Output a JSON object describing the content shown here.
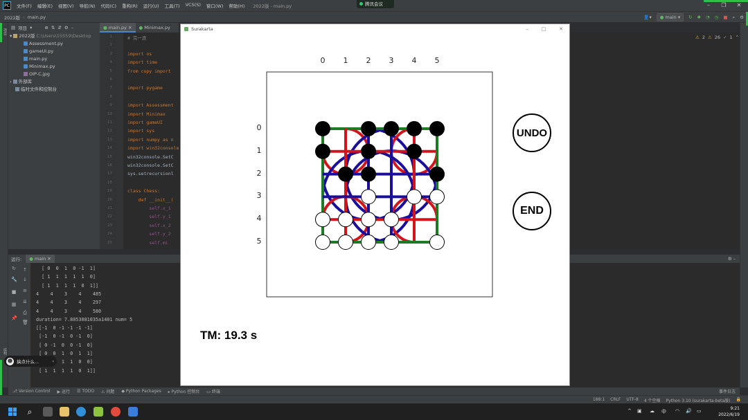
{
  "ide": {
    "menus": [
      "文件(F)",
      "编辑(E)",
      "视图(V)",
      "导航(N)",
      "代码(C)",
      "重构(R)",
      "运行(U)",
      "工具(T)",
      "VCS(S)",
      "窗口(W)",
      "帮助(H)"
    ],
    "window_title": "2022版 - main.py",
    "meeting_app": "腾讯会议",
    "breadcrumb": [
      "2022版",
      "main.py"
    ],
    "run_config": "main",
    "project_label": "项目",
    "tabs": [
      "main.py",
      "Minimax.py"
    ],
    "project_tree": {
      "root": "2022版",
      "root_path": "C:\\Users\\15559\\Desktop",
      "files": [
        "Assessment.py",
        "gameUI.py",
        "main.py",
        "Minimax.py",
        "OIP-C.jpg"
      ],
      "ext_libs": "外部库",
      "scratches": "临时文件和控制台"
    },
    "warnings": {
      "warn": "2",
      "weak": "26",
      "typo": "1"
    },
    "line_numbers": [
      "1",
      "2",
      "3",
      "4",
      "5",
      "6",
      "7",
      "8",
      "9",
      "10",
      "11",
      "12",
      "13",
      "14",
      "15",
      "16",
      "17",
      "18",
      "19",
      "20",
      "21",
      "22",
      "23",
      "24",
      "25"
    ],
    "code_lines": [
      {
        "t": "# 完一逐",
        "cls": "cm"
      },
      {
        "t": ""
      },
      {
        "t": "import os",
        "cls": "imp"
      },
      {
        "t": "import time",
        "cls": "imp"
      },
      {
        "t": "from copy import",
        "cls": "imp"
      },
      {
        "t": ""
      },
      {
        "t": "import pygame",
        "cls": "imp"
      },
      {
        "t": ""
      },
      {
        "t": "import Assessment",
        "cls": "imp"
      },
      {
        "t": "import Minimax",
        "cls": "imp"
      },
      {
        "t": "import gameUI",
        "cls": "imp"
      },
      {
        "t": "import sys",
        "cls": "imp"
      },
      {
        "t": "import numpy as n",
        "cls": "imp"
      },
      {
        "t": "import win32console",
        "cls": "imp"
      },
      {
        "t": "win32console.SetC",
        "cls": ""
      },
      {
        "t": "win32console.SetC",
        "cls": ""
      },
      {
        "t": "sys.setrecursionl",
        "cls": ""
      },
      {
        "t": ""
      },
      {
        "t": "class Chess:",
        "cls": "cls"
      },
      {
        "t": "    def __init__(",
        "cls": "def"
      },
      {
        "t": "        self.x_1",
        "cls": "self"
      },
      {
        "t": "        self.y_1",
        "cls": "self"
      },
      {
        "t": "        self.x_2",
        "cls": "self"
      },
      {
        "t": "        self.y_2",
        "cls": "self"
      },
      {
        "t": "        self.mi",
        "cls": "self"
      }
    ],
    "run_panel": {
      "label": "运行:",
      "tab": "main",
      "console": [
        "  [ 0  0  1  0 -1  1]",
        "  [ 1  1  1  1  1  0]",
        "  [ 1  1  1  1  0  1]]",
        "4    4    3    4    485",
        "4    4    3    4    297",
        "4    4    3    4    580",
        "duration= 7.8053081035a1401 num= 5",
        "[[-1  0 -1 -1 -1 -1]",
        " [-1  0 -1  0 -1  0]",
        " [ 0 -1  0  0 -1  0]",
        " [ 0  0  1  0  1  1]",
        " [ 1  1  1  1  0  0]",
        " [ 1  1  1  1  0  1]]"
      ]
    },
    "bubble_text": "搞点什么...",
    "bottom_tools": [
      "Version Control",
      "运行",
      "TODO",
      "问题",
      "Python Packages",
      "Python 控制台",
      "终端"
    ],
    "event_log": "事件日志",
    "status": {
      "pos": "188:1",
      "crlf": "CRLF",
      "enc": "UTF-8",
      "indent": "4 个空格",
      "interp": "Python 3.10 (surakarta-beta版)"
    },
    "clock": {
      "time": "9:21",
      "date": "2022/6/19"
    },
    "tray": [
      "^",
      "中"
    ]
  },
  "game": {
    "window_title": "Surakarta",
    "col_labels": [
      "0",
      "1",
      "2",
      "3",
      "4",
      "5"
    ],
    "row_labels": [
      "0",
      "1",
      "2",
      "3",
      "4",
      "5"
    ],
    "board": [
      [
        "B",
        "E",
        "B",
        "B",
        "B",
        "B"
      ],
      [
        "B",
        "E",
        "B",
        "E",
        "B",
        "E"
      ],
      [
        "E",
        "B",
        "B",
        "E",
        "E",
        "B"
      ],
      [
        "E",
        "E",
        "W",
        "E",
        "W",
        "W"
      ],
      [
        "W",
        "W",
        "W",
        "W",
        "E",
        "E"
      ],
      [
        "W",
        "W",
        "W",
        "W",
        "E",
        "W"
      ]
    ],
    "colors": {
      "outer_loop": "#1a0f9c",
      "inner_loop": "#d4141b",
      "green_line": "#1d7a25",
      "black_piece": "#000000",
      "white_piece": "#ffffff"
    },
    "undo_label": "UNDO",
    "end_label": "END",
    "timer": "TM: 19.3 s"
  }
}
